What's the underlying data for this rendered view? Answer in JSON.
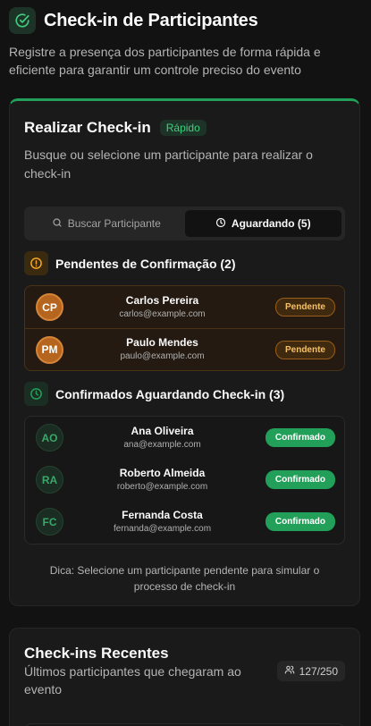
{
  "header": {
    "icon": "check-circle-icon",
    "title": "Check-in de Participantes",
    "subtitle": "Registre a presença dos participantes de forma rápida e eficiente para garantir um controle preciso do evento"
  },
  "checkin_card": {
    "title": "Realizar Check-in",
    "chip": "Rápido",
    "description": "Busque ou selecione um participante para realizar o check-in",
    "accent_color": "#22a05a",
    "tabs": [
      {
        "label": "Buscar Participante",
        "icon": "search-icon",
        "active": false
      },
      {
        "label": "Aguardando (5)",
        "icon": "clock-icon",
        "active": true
      }
    ],
    "pending_section": {
      "title": "Pendentes de Confirmação (2)",
      "icon": "alert-circle-icon",
      "color": "#f5a623",
      "items": [
        {
          "initials": "CP",
          "name": "Carlos Pereira",
          "email": "carlos@example.com",
          "status": "Pendente"
        },
        {
          "initials": "PM",
          "name": "Paulo Mendes",
          "email": "paulo@example.com",
          "status": "Pendente"
        }
      ]
    },
    "confirmed_section": {
      "title": "Confirmados Aguardando Check-in (3)",
      "icon": "clock-icon",
      "color": "#22a05a",
      "items": [
        {
          "initials": "AO",
          "name": "Ana Oliveira",
          "email": "ana@example.com",
          "status": "Confirmado"
        },
        {
          "initials": "RA",
          "name": "Roberto Almeida",
          "email": "roberto@example.com",
          "status": "Confirmado"
        },
        {
          "initials": "FC",
          "name": "Fernanda Costa",
          "email": "fernanda@example.com",
          "status": "Confirmado"
        }
      ]
    },
    "tip": "Dica: Selecione um participante pendente para simular o processo de check-in"
  },
  "recent_card": {
    "title": "Check-ins Recentes",
    "description": "Últimos participantes que chegaram ao evento",
    "count": "127/250",
    "count_icon": "users-icon"
  }
}
